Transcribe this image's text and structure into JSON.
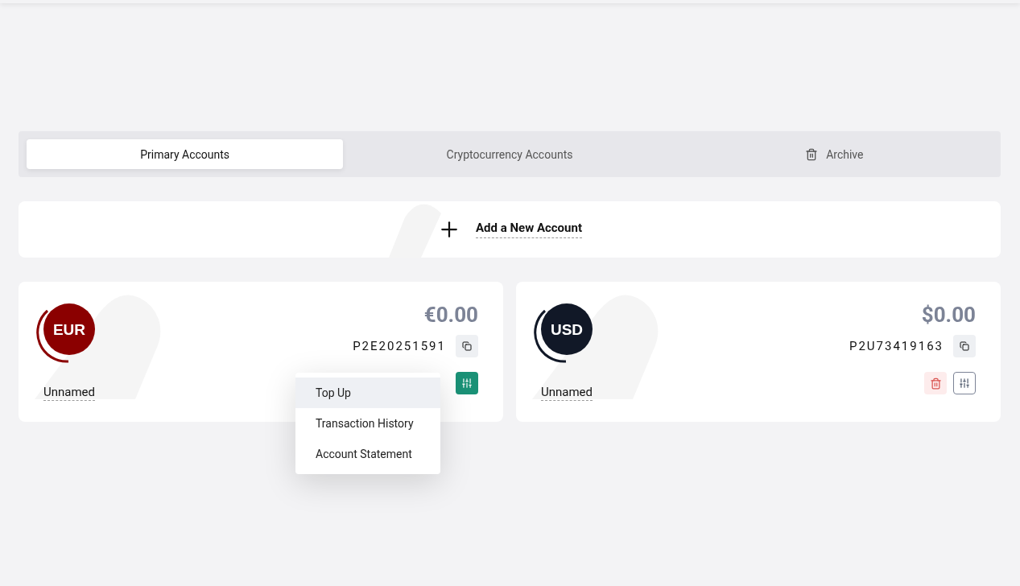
{
  "tabs": [
    {
      "label": "Primary Accounts",
      "selected": true,
      "kind": "plain"
    },
    {
      "label": "Cryptocurrency Accounts",
      "selected": false,
      "kind": "plain"
    },
    {
      "label": "Archive",
      "selected": false,
      "kind": "archive"
    }
  ],
  "add_account": {
    "label": "Add a New Account"
  },
  "accounts": [
    {
      "code": "EUR",
      "color": "#8b0000",
      "balance": "€0.00",
      "number": "P2E20251591",
      "name": "Unnamed",
      "menu": [
        {
          "label": "Top Up",
          "selected": true
        },
        {
          "label": "Transaction History",
          "selected": false
        },
        {
          "label": "Account Statement",
          "selected": false
        }
      ]
    },
    {
      "code": "USD",
      "color": "#111827",
      "balance": "$0.00",
      "number": "P2U73419163",
      "name": "Unnamed"
    }
  ]
}
